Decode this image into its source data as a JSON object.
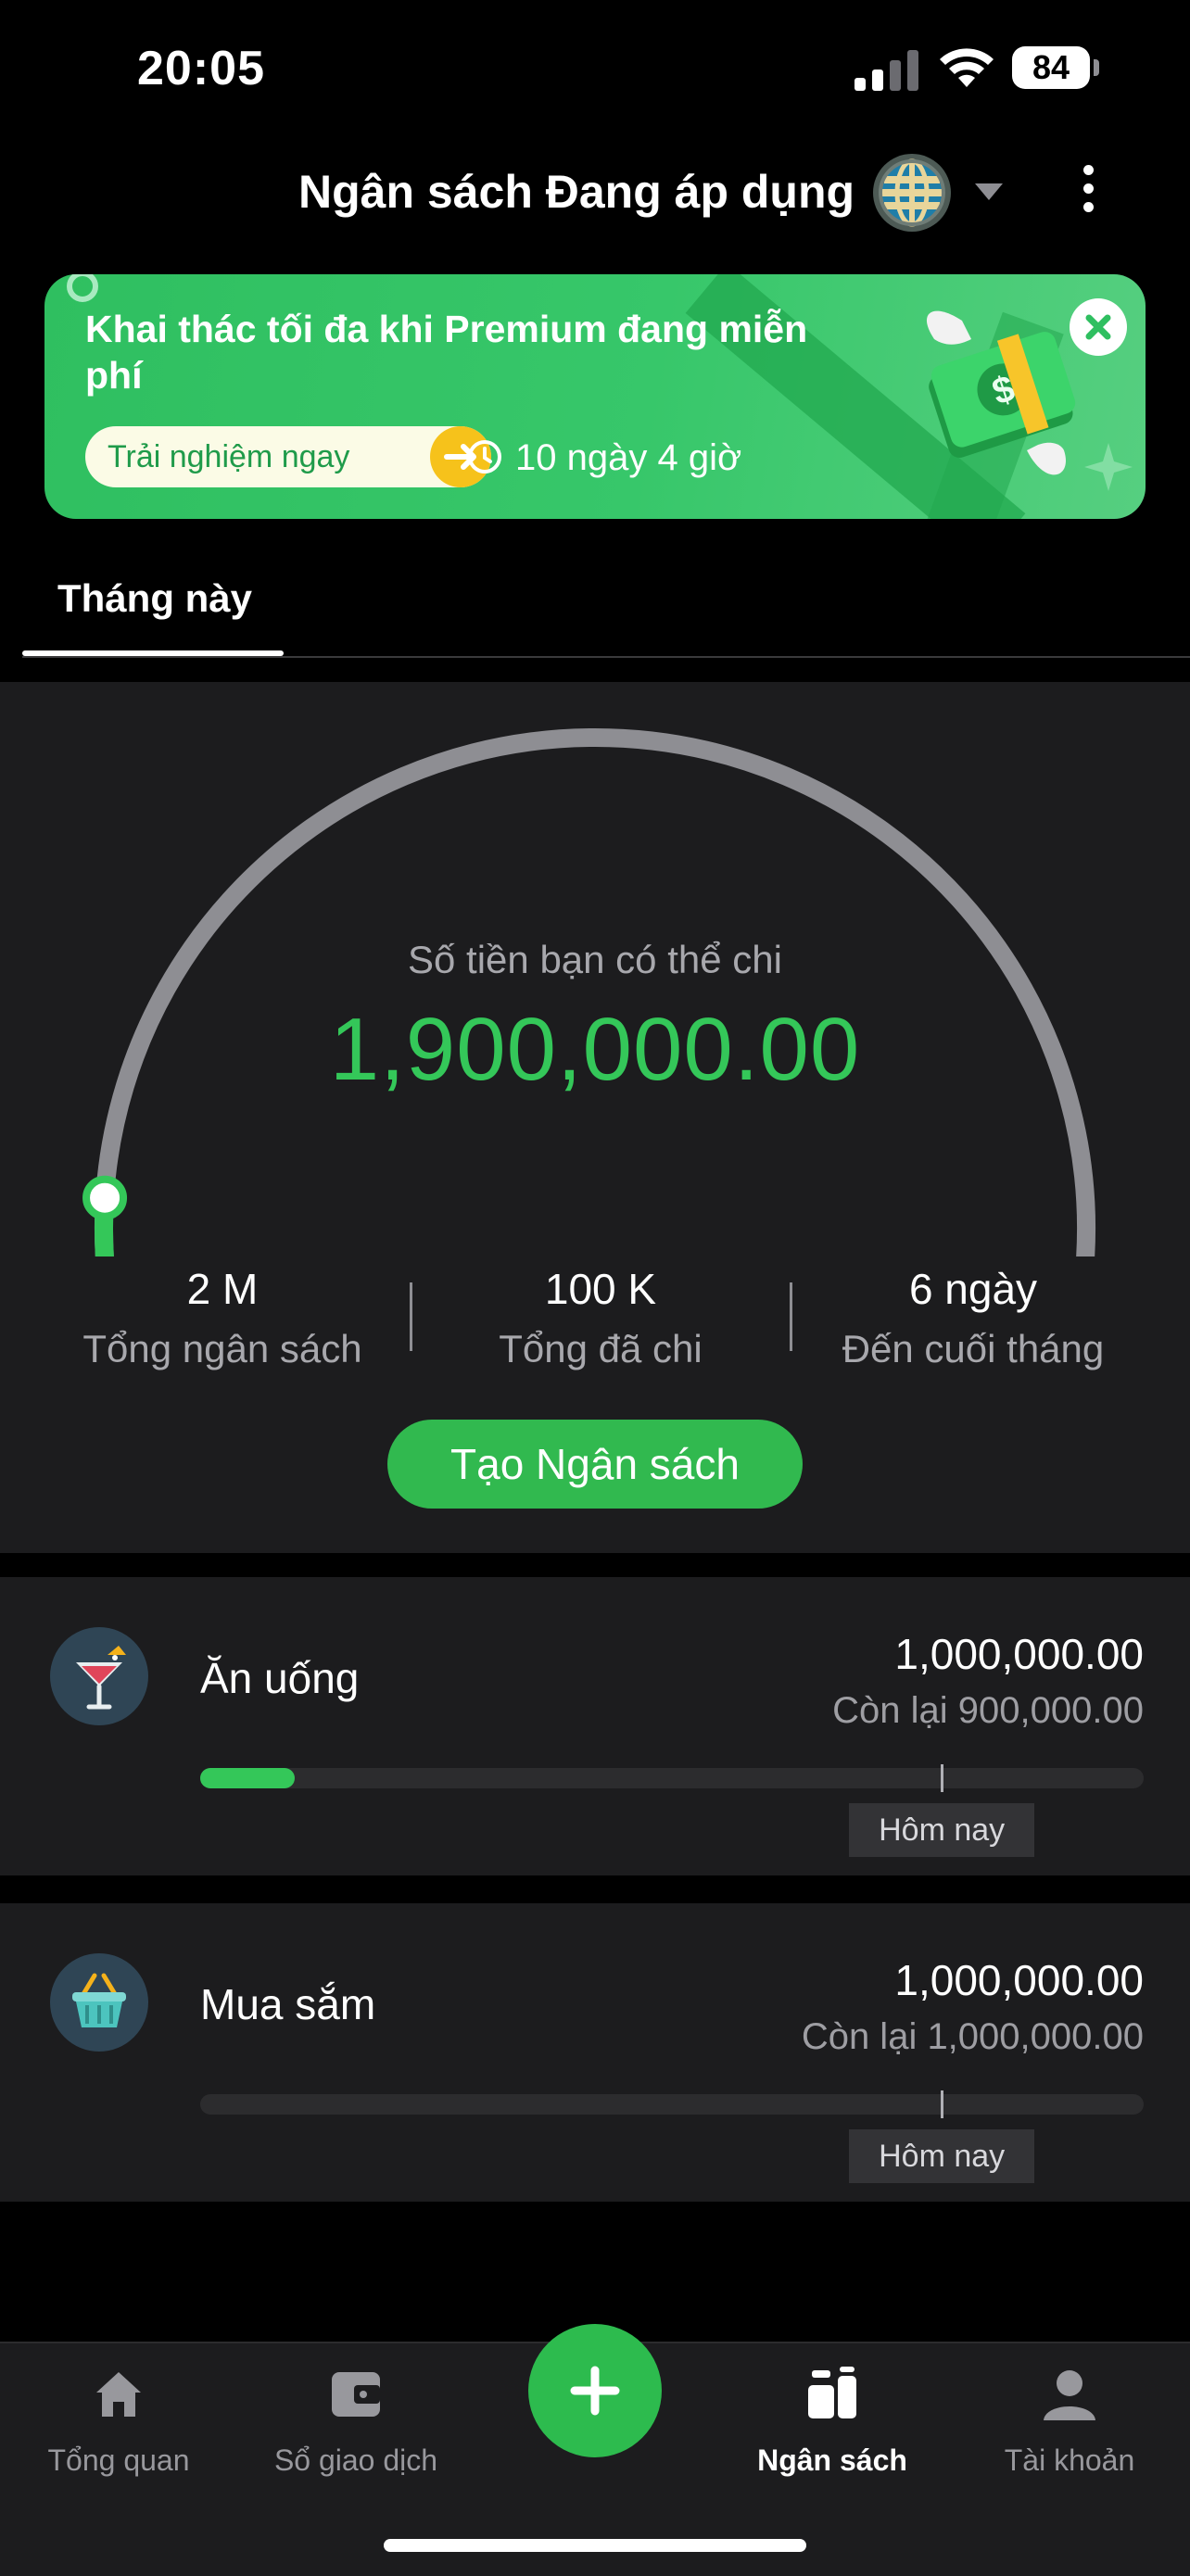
{
  "status_bar": {
    "time": "20:05",
    "battery": "84"
  },
  "header": {
    "title": "Ngân sách Đang áp dụng",
    "globe_icon": "globe-icon",
    "menu_icon": "kebab-icon"
  },
  "banner": {
    "title": "Khai thác tối đa khi Premium đang miễn phí",
    "cta_label": "Trải nghiệm ngay",
    "countdown": "10 ngày 4 giờ",
    "accent": "#2fbf60"
  },
  "tabs": [
    {
      "label": "Tháng này",
      "active": true
    }
  ],
  "summary": {
    "spend_label": "Số tiền bạn có thể chi",
    "spend_amount": "1,900,000.00",
    "progress_used_fraction": 0.05,
    "stats": [
      {
        "value": "2 M",
        "label": "Tổng ngân sách"
      },
      {
        "value": "100 K",
        "label": "Tổng đã chi"
      },
      {
        "value": "6 ngày",
        "label": "Đến cuối tháng"
      }
    ],
    "create_button": "Tạo Ngân sách"
  },
  "budgets": [
    {
      "name": "Ăn uống",
      "icon": "cocktail-icon",
      "amount": "1,000,000.00",
      "remaining": "Còn lại 900,000.00",
      "spent_fraction": 0.1,
      "today_label": "Hôm nay"
    },
    {
      "name": "Mua sắm",
      "icon": "shopping-basket-icon",
      "amount": "1,000,000.00",
      "remaining": "Còn lại 1,000,000.00",
      "spent_fraction": 0.0,
      "today_label": "Hôm nay"
    }
  ],
  "today_fraction": 0.786,
  "nav": [
    {
      "label": "Tổng quan",
      "icon": "home-icon",
      "active": false
    },
    {
      "label": "Sổ giao dịch",
      "icon": "wallet-icon",
      "active": false
    },
    {
      "label": "Ngân sách",
      "icon": "budget-icon",
      "active": true
    },
    {
      "label": "Tài khoản",
      "icon": "user-icon",
      "active": false
    }
  ],
  "colors": {
    "green": "#34c759",
    "background": "#000000",
    "panel": "#1c1c1e"
  }
}
